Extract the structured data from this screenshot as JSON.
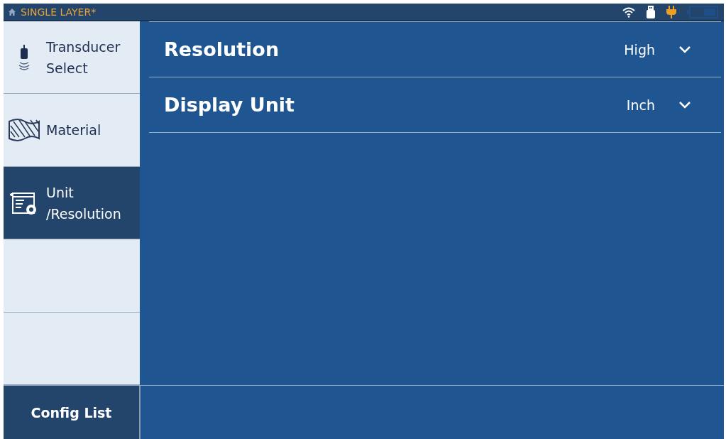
{
  "status_bar": {
    "title": "SINGLE LAYER*",
    "charging": true
  },
  "sidebar": {
    "items": [
      {
        "label": "Transducer\nSelect",
        "kind": "transducer",
        "selected": false
      },
      {
        "label": "Material",
        "kind": "material",
        "selected": false
      },
      {
        "label": "Unit\n/Resolution",
        "kind": "unit",
        "selected": true
      }
    ]
  },
  "settings": [
    {
      "label": "Resolution",
      "value": "High"
    },
    {
      "label": "Display Unit",
      "value": "Inch"
    }
  ],
  "footer": {
    "button": "Config List"
  }
}
